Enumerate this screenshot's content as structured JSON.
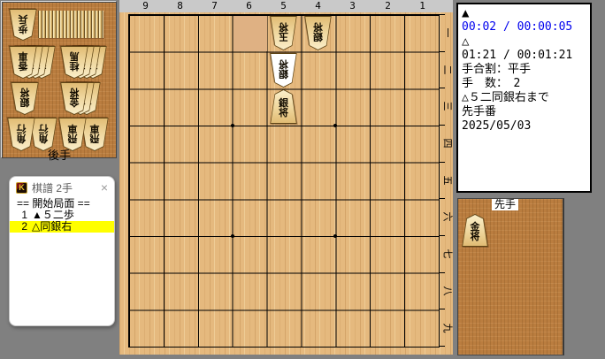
{
  "app": {
    "window_bg": "#808080"
  },
  "gote_stand": {
    "label": "後手",
    "pieces": [
      {
        "name": "pawn",
        "kanji": "歩兵",
        "count": 18
      },
      {
        "name": "lance",
        "kanji": "香車",
        "count": 4
      },
      {
        "name": "knight",
        "kanji": "桂馬",
        "count": 4
      },
      {
        "name": "silver",
        "kanji": "銀将",
        "count": 1
      },
      {
        "name": "gold",
        "kanji": "金将",
        "count": 3
      },
      {
        "name": "bishop",
        "kanji": "角行",
        "count": 2
      },
      {
        "name": "rook",
        "kanji": "飛車",
        "count": 2
      }
    ]
  },
  "sente_stand": {
    "label": "先手",
    "pieces": [
      {
        "name": "gold",
        "kanji": "金将",
        "count": 1
      }
    ]
  },
  "kifu_window": {
    "icon_letter": "K",
    "title": "棋譜 2手",
    "close_label": "×",
    "header": "== 開始局面 ==",
    "moves": [
      {
        "no": "1",
        "text": "▲５二歩",
        "current": false
      },
      {
        "no": "2",
        "text": "△同銀右",
        "current": true
      }
    ],
    "current_move_bg": "#ffff00"
  },
  "board": {
    "file_labels": [
      "9",
      "8",
      "7",
      "6",
      "5",
      "4",
      "3",
      "2",
      "1"
    ],
    "rank_labels": [
      "一",
      "二",
      "三",
      "四",
      "五",
      "六",
      "七",
      "八",
      "九"
    ],
    "highlighted_square": "6一",
    "pieces": [
      {
        "square": "5一",
        "kanji": "玉将",
        "side": "gote",
        "just_moved": false
      },
      {
        "square": "4一",
        "kanji": "銀将",
        "side": "gote",
        "just_moved": false
      },
      {
        "square": "5二",
        "kanji": "銀将",
        "side": "gote",
        "just_moved": true
      },
      {
        "square": "5三",
        "kanji": "銀将",
        "side": "sente",
        "just_moved": false
      }
    ],
    "colors": {
      "board_wood": "#e5b97e",
      "stand_wood": "#ba7d3f",
      "square_highlight": "#dfb183",
      "moved_piece_bg": "#ffffff",
      "grid_line": "#000000"
    }
  },
  "info_panel": {
    "sente_mark": "▲",
    "sente_time": "00:02 / 00:00:05",
    "time_active_color": "#0000ee",
    "gote_mark": "△",
    "gote_time": "01:21 / 00:01:21",
    "handicap": "手合割：平手",
    "move_count": "手　数：　2",
    "last_move": "△５二同銀右まで",
    "turn": "先手番",
    "date": "2025/05/03"
  }
}
